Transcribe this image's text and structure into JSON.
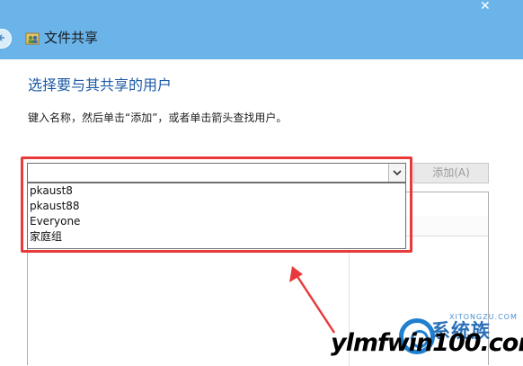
{
  "window": {
    "title": "文件共享",
    "close_glyph": "✕"
  },
  "main": {
    "heading": "选择要与其共享的用户",
    "instruction": "键入名称，然后单击“添加”，或者单击箭头查找用户。",
    "combo_value": "",
    "add_label": "添加(A)",
    "dropdown_items": [
      "pkaust8",
      "pkaust88",
      "Everyone",
      "家庭组"
    ]
  },
  "watermark": {
    "brand": "系统族",
    "sub": "XITONGZU.COM",
    "url": "ylmfwin100.com"
  },
  "colors": {
    "titlebar": "#6ab4ea",
    "heading": "#1d5aa6",
    "highlight": "#e83a3a",
    "arrow": "#e83a3a"
  },
  "icons": {
    "back": "back-arrow-icon",
    "app": "users-share-icon",
    "dropdown": "chevron-down-icon"
  }
}
